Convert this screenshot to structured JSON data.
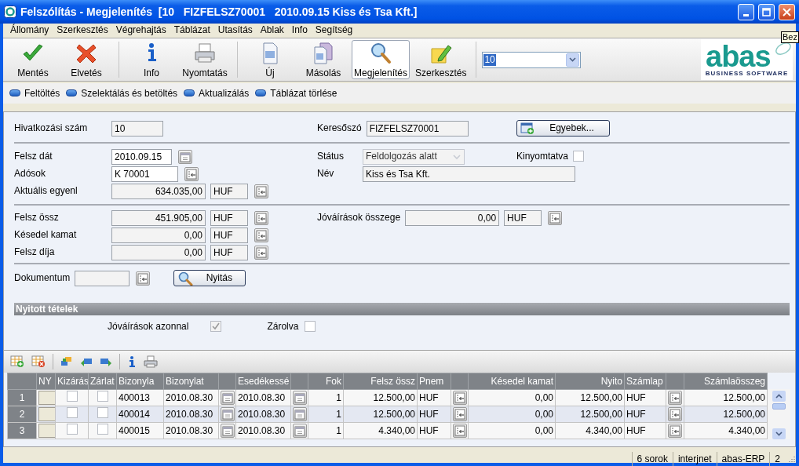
{
  "window": {
    "title": "Felszólítás - Megjelenítés  [10   FIZFELSZ70001   2010.09.15 Kiss és Tsa Kft.]"
  },
  "tooltip": "Bez",
  "menu": [
    "Állomány",
    "Szerkesztés",
    "Végrehajtás",
    "Táblázat",
    "Utasítás",
    "Ablak",
    "Info",
    "Segítség"
  ],
  "toolbar": {
    "groups": [
      [
        {
          "kind": "save",
          "label": "Mentés",
          "selected": false
        },
        {
          "kind": "discard",
          "label": "Elvetés",
          "selected": false
        }
      ],
      [
        {
          "kind": "info",
          "label": "Info",
          "selected": false
        },
        {
          "kind": "print",
          "label": "Nyomtatás",
          "selected": false
        }
      ],
      [
        {
          "kind": "new",
          "label": "Új",
          "selected": false
        },
        {
          "kind": "copy",
          "label": "Másolás",
          "selected": false
        },
        {
          "kind": "display",
          "label": "Megjelenítés",
          "selected": true
        },
        {
          "kind": "edit",
          "label": "Szerkesztés",
          "selected": false
        }
      ]
    ],
    "combo": {
      "value": "10"
    }
  },
  "logo": {
    "wordmark": "abas",
    "tagline": "BUSINESS SOFTWARE"
  },
  "actions": [
    "Feltöltés",
    "Szelektálás és betöltés",
    "Aktualizálás",
    "Táblázat törlése"
  ],
  "form": {
    "sections": [
      {
        "rows": [
          {
            "left": {
              "kind": "code",
              "label": "Hivatkozási szám",
              "value": "10"
            },
            "right": {
              "kind": "search",
              "label": "Keresőszó",
              "value": "FIZFELSZ70001"
            },
            "extra": {
              "kind": "button",
              "label": "Egyebek..."
            }
          }
        ]
      },
      {
        "rows": [
          {
            "left": {
              "kind": "date",
              "label": "Felsz dát",
              "value": "2010.09.15"
            },
            "right": {
              "kind": "select",
              "label": "Státus",
              "value": "Feldolgozás alatt",
              "disabled": true
            },
            "extra": {
              "kind": "checkbox",
              "label": "Kinyomtatva",
              "checked": false
            }
          },
          {
            "left": {
              "kind": "lookup",
              "label": "Adósok",
              "value": "K 70001"
            },
            "right": {
              "kind": "name",
              "label": "Név",
              "value": "Kiss és Tsa Kft."
            }
          },
          {
            "left": {
              "kind": "amount",
              "label": "Aktuális egyenl",
              "value": "634.035,00",
              "currency": "HUF"
            }
          }
        ]
      },
      {
        "rows": [
          {
            "left": {
              "kind": "amount",
              "label": "Felsz össz",
              "value": "451.905,00",
              "currency": "HUF"
            },
            "right": {
              "kind": "amount",
              "label": "Jóváírások összege",
              "value": "0,00",
              "currency": "HUF"
            }
          },
          {
            "left": {
              "kind": "amount",
              "label": "Késedel kamat",
              "value": "0,00",
              "currency": "HUF"
            }
          },
          {
            "left": {
              "kind": "amount",
              "label": "Felsz díja",
              "value": "0,00",
              "currency": "HUF"
            }
          }
        ]
      },
      {
        "rows": [
          {
            "left": {
              "kind": "document",
              "label": "Dokumentum",
              "button": "Nyitás"
            }
          }
        ]
      }
    ]
  },
  "open_items": {
    "title": "Nyitott tételek",
    "options": [
      {
        "label": "Jóváírások azonnal",
        "checked": true,
        "disabled": true
      },
      {
        "label": "Zárolva",
        "checked": false,
        "disabled": false
      }
    ]
  },
  "table": {
    "columns": [
      {
        "kind": "rownum"
      },
      {
        "kind": "button",
        "label": "NY"
      },
      {
        "kind": "check",
        "label": "Kizárás"
      },
      {
        "kind": "check",
        "label": "Zárlat"
      },
      {
        "kind": "text",
        "label": "Bizonyla"
      },
      {
        "kind": "text",
        "label": "Bizonylat"
      },
      {
        "kind": "date-button"
      },
      {
        "kind": "text",
        "label": "Esedékessé"
      },
      {
        "kind": "date-button"
      },
      {
        "kind": "number",
        "label": "Fok"
      },
      {
        "kind": "number",
        "label": "Felsz össz"
      },
      {
        "kind": "text",
        "label": "Pnem"
      },
      {
        "kind": "lookup-button"
      },
      {
        "kind": "number",
        "label": "Késedel kamat"
      },
      {
        "kind": "number",
        "label": "Nyito"
      },
      {
        "kind": "text",
        "label": "Számlap"
      },
      {
        "kind": "lookup-button"
      },
      {
        "kind": "number",
        "label": "Számlaösszeg"
      }
    ],
    "rows": [
      {
        "selected": false,
        "checks": [
          false,
          false
        ],
        "cells": [
          "1",
          "",
          "",
          "",
          "400013",
          "2010.08.30",
          "",
          "2010.08.30",
          "",
          "1",
          "12.500,00",
          "HUF",
          "",
          "0,00",
          "12.500,00",
          "HUF",
          "",
          "12.500,00"
        ]
      },
      {
        "selected": true,
        "checks": [
          false,
          false
        ],
        "cells": [
          "2",
          "",
          "",
          "",
          "400014",
          "2010.08.30",
          "",
          "2010.08.30",
          "",
          "1",
          "12.500,00",
          "HUF",
          "",
          "0,00",
          "12.500,00",
          "HUF",
          "",
          "12.500,00"
        ]
      },
      {
        "selected": false,
        "checks": [
          false,
          false
        ],
        "cells": [
          "3",
          "",
          "",
          "",
          "400015",
          "2010.08.30",
          "",
          "2010.08.30",
          "",
          "1",
          "4.340,00",
          "HUF",
          "",
          "0,00",
          "4.340,00",
          "HUF",
          "",
          "4.340,00"
        ]
      }
    ]
  },
  "status_bar": [
    "6 sorok",
    "interjnet",
    "abas-ERP",
    "2"
  ]
}
